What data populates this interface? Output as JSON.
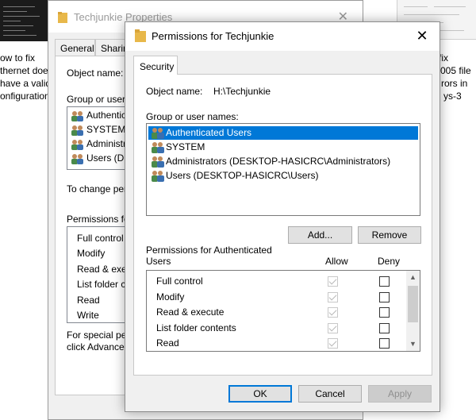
{
  "desktop": {
    "left_text": [
      "ow to fix",
      "thernet doe",
      "have a valid",
      "onfiguration"
    ],
    "right_text": [
      "fix",
      "005 file",
      "rors in",
      "ys-3"
    ]
  },
  "back_window": {
    "title": "Techjunkie Properties",
    "tabs": [
      "General",
      "Sharin"
    ],
    "object_name_label": "Object name:",
    "group_label": "Group or user n",
    "groups": [
      "Authenticat",
      "SYSTEM",
      "Administrat",
      "Users (DE"
    ],
    "change_text": "To change per",
    "permissions_label": "Permissions for",
    "permissions": [
      "Full control",
      "Modify",
      "Read & exec",
      "List folder co",
      "Read",
      "Write"
    ],
    "special_line1": "For special per",
    "special_line2": "click Advanced"
  },
  "dialog": {
    "title": "Permissions for Techjunkie",
    "close_glyph": "✕",
    "tab_security": "Security",
    "object_name_label": "Object name:",
    "object_name_value": "H:\\Techjunkie",
    "group_label": "Group or user names:",
    "groups": [
      "Authenticated Users",
      "SYSTEM",
      "Administrators (DESKTOP-HASICRC\\Administrators)",
      "Users (DESKTOP-HASICRC\\Users)"
    ],
    "selected_group": "Authenticated Users",
    "add_button": "Add...",
    "remove_button": "Remove",
    "permissions_for_line1": "Permissions for Authenticated",
    "permissions_for_line2": "Users",
    "allow_header": "Allow",
    "deny_header": "Deny",
    "permissions": [
      {
        "name": "Full control",
        "allow": true,
        "deny": false
      },
      {
        "name": "Modify",
        "allow": true,
        "deny": false
      },
      {
        "name": "Read & execute",
        "allow": true,
        "deny": false
      },
      {
        "name": "List folder contents",
        "allow": true,
        "deny": false
      },
      {
        "name": "Read",
        "allow": true,
        "deny": false
      }
    ],
    "ok_button": "OK",
    "cancel_button": "Cancel",
    "apply_button": "Apply",
    "scroll_up_glyph": "▲",
    "scroll_down_glyph": "▼"
  },
  "colors": {
    "selection": "#0078d7",
    "window_bg": "#f0f0f0",
    "folder": "#e8b84a"
  }
}
